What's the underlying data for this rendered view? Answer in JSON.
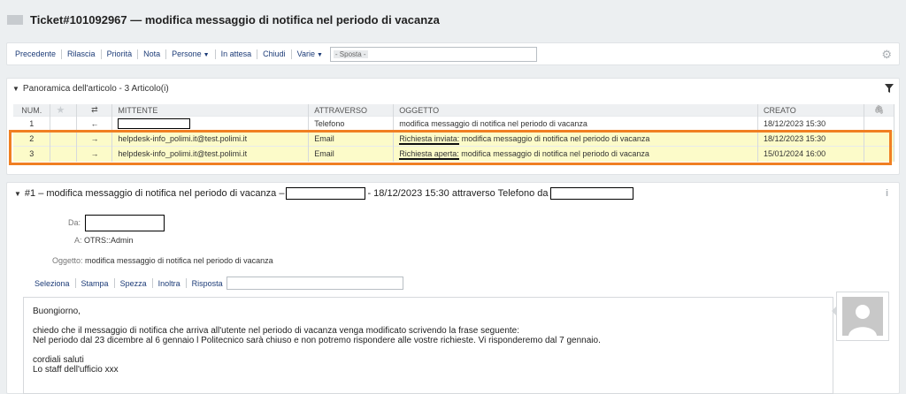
{
  "ticket": {
    "title": "Ticket#101092967 — modifica messaggio di notifica nel periodo di vacanza"
  },
  "toolbar": {
    "items": [
      "Precedente",
      "Rilascia",
      "Priorità",
      "Nota",
      "Persone",
      "In attesa",
      "Chiudi",
      "Varie"
    ],
    "move_value": "- Sposta -"
  },
  "overview": {
    "title": "Panoramica dell'articolo - 3 Articolo(i)",
    "columns": [
      "NUM.",
      "",
      "⇄",
      "MITTENTE",
      "ATTRAVERSO",
      "OGGETTO",
      "CREATO",
      ""
    ],
    "rows": [
      {
        "num": "1",
        "dir": "←",
        "from": "",
        "via": "Telefono",
        "subject_prefix": "",
        "subject": "modifica messaggio di notifica nel periodo di vacanza",
        "created": "18/12/2023 15:30"
      },
      {
        "num": "2",
        "dir": "→",
        "from": "helpdesk-info_polimi.it@test.polimi.it",
        "via": "Email",
        "subject_prefix": "Richiesta inviata:",
        "subject": " modifica messaggio di notifica nel periodo di vacanza",
        "created": "18/12/2023 15:30"
      },
      {
        "num": "3",
        "dir": "→",
        "from": "helpdesk-info_polimi.it@test.polimi.it",
        "via": "Email",
        "subject_prefix": "Richiesta aperta:",
        "subject": " modifica messaggio di notifica nel periodo di vacanza",
        "created": "15/01/2024 16:00"
      }
    ]
  },
  "article": {
    "header_prefix": "#1 – modifica messaggio di notifica nel periodo di vacanza –",
    "header_mid": "- 18/12/2023 15:30 attraverso Telefono da",
    "from_label": "Da:",
    "to_label": "A:",
    "to_value": "OTRS::Admin",
    "subject_label": "Oggetto:",
    "subject_value": "modifica messaggio di notifica nel periodo di vacanza",
    "actions": [
      "Seleziona",
      "Stampa",
      "Spezza",
      "Inoltra",
      "Risposta"
    ],
    "body": {
      "greeting": "Buongiorno,",
      "line1": "chiedo che il messaggio di notifica che arriva all'utente nel periodo di vacanza venga modificato scrivendo la frase seguente:",
      "line2": "Nel periodo dal 23 dicembre al 6 gennaio l Politecnico sarà chiuso e non potremo rispondere alle vostre richieste. Vi risponderemo dal 7 gennaio.",
      "closing": "cordiali saluti",
      "signature": "Lo staff dell'ufficio xxx"
    }
  },
  "colors": {
    "highlight_border": "#f07f22",
    "highlight_row": "#fcfbc9",
    "link": "#1d3c78"
  }
}
